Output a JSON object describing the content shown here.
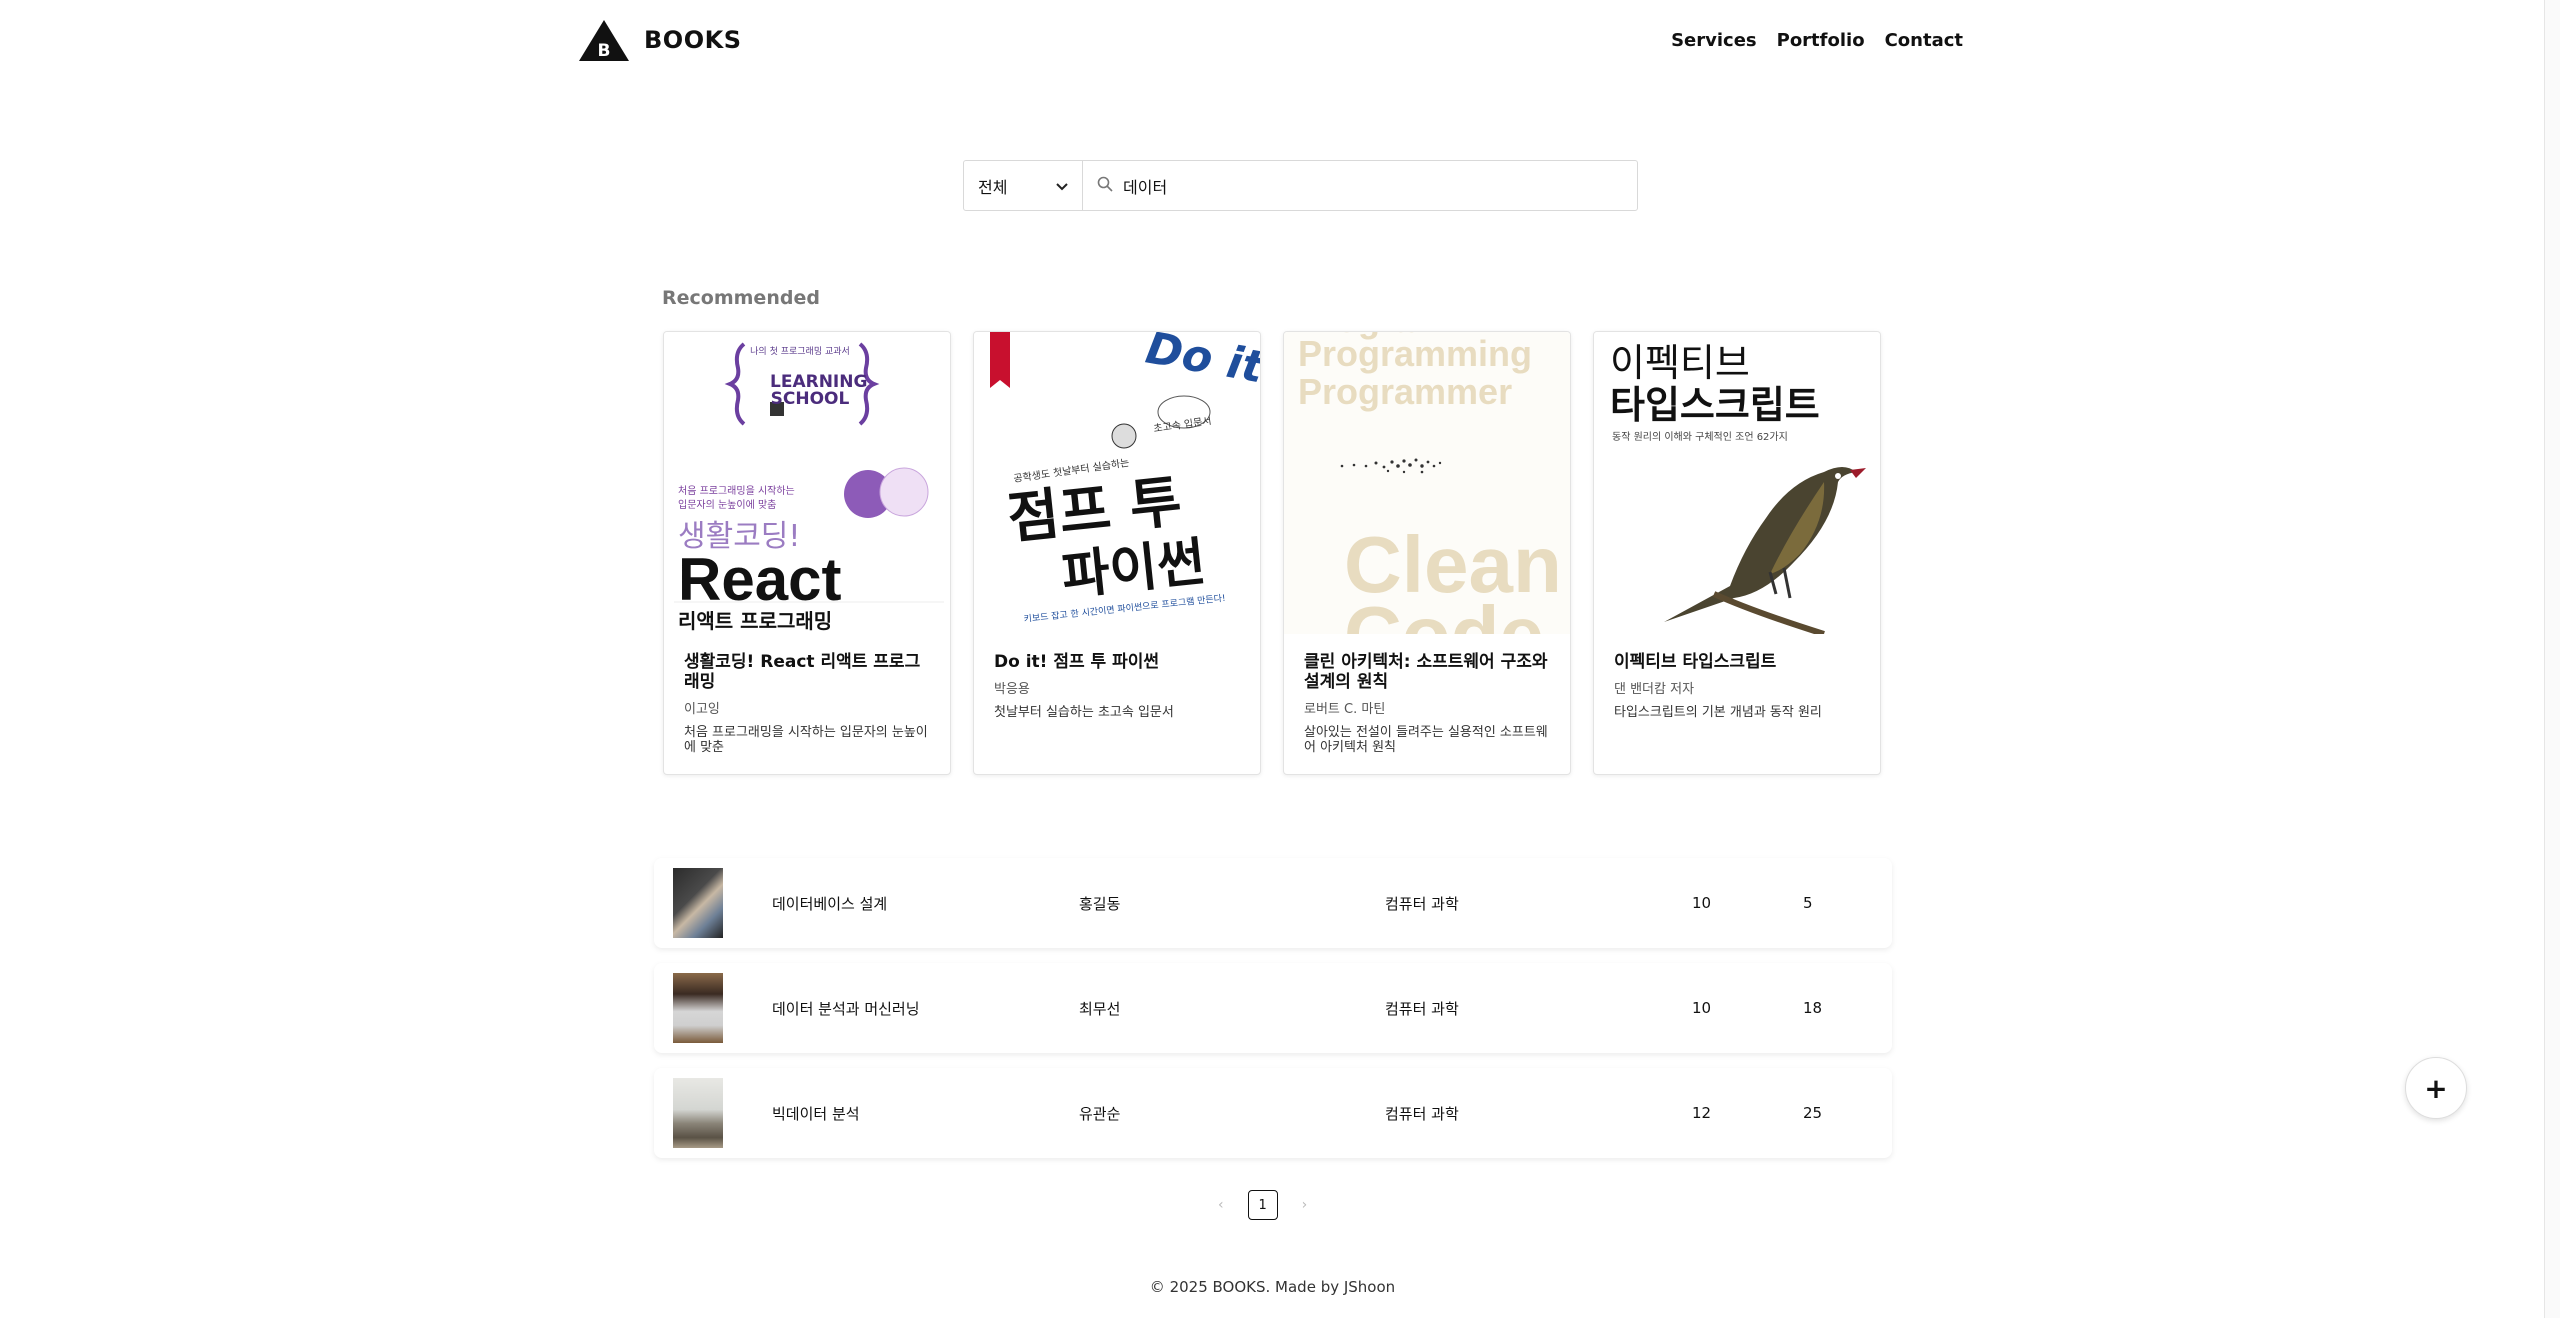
{
  "header": {
    "brand": "BOOKS",
    "logo_letter": "B",
    "nav": [
      "Services",
      "Portfolio",
      "Contact"
    ]
  },
  "search": {
    "category": "전체",
    "query": "데이터"
  },
  "recommended": {
    "title": "Recommended",
    "books": [
      {
        "cover_title": "생활코딩!",
        "cover_sub": "React",
        "cover_sub2": "리액트 프로그래밍",
        "cover_top": "LEARNING SCHOOL",
        "cover_note": "처음 프로그래밍을 시작하는 입문자의 눈높이에 맞춘",
        "title": "생활코딩! React 리액트 프로그래밍",
        "author": "이고잉",
        "desc": "처음 프로그래밍을 시작하는 입문자의 눈높이에 맞춘"
      },
      {
        "cover_title": "점프 투",
        "cover_sub": "파이썬",
        "cover_top": "Do it!",
        "title": "Do it! 점프 투 파이썬",
        "author": "박응용",
        "desc": "첫날부터 실습하는 초고속 입문서"
      },
      {
        "cover_title": "Programming",
        "cover_sub": "Programmer",
        "cover_big": "Clean",
        "cover_big2": "Code",
        "title": "클린 아키텍처: 소프트웨어 구조와 설계의 원칙",
        "author": "로버트 C. 마틴",
        "desc": "살아있는 전설이 들려주는 실용적인 소프트웨어 아키텍처 원칙"
      },
      {
        "cover_title": "이펙티브",
        "cover_sub": "타입스크립트",
        "cover_note": "동작 원리의 이해와 구체적인 조언 62가지",
        "title": "이펙티브 타입스크립트",
        "author": "댄 밴더캄 저자",
        "desc": "타입스크립트의 기본 개념과 동작 원리"
      }
    ]
  },
  "results": [
    {
      "title": "데이터베이스 설계",
      "author": "홍길동",
      "category": "컴퓨터 과학",
      "num1": "10",
      "num2": "5"
    },
    {
      "title": "데이터 분석과 머신러닝",
      "author": "최무선",
      "category": "컴퓨터 과학",
      "num1": "10",
      "num2": "18"
    },
    {
      "title": "빅데이터 분석",
      "author": "유관순",
      "category": "컴퓨터 과학",
      "num1": "12",
      "num2": "25"
    }
  ],
  "pagination": {
    "prev": "‹",
    "current": "1",
    "next": "›"
  },
  "footer": "© 2025 BOOKS. Made by JShoon",
  "fab": "+"
}
